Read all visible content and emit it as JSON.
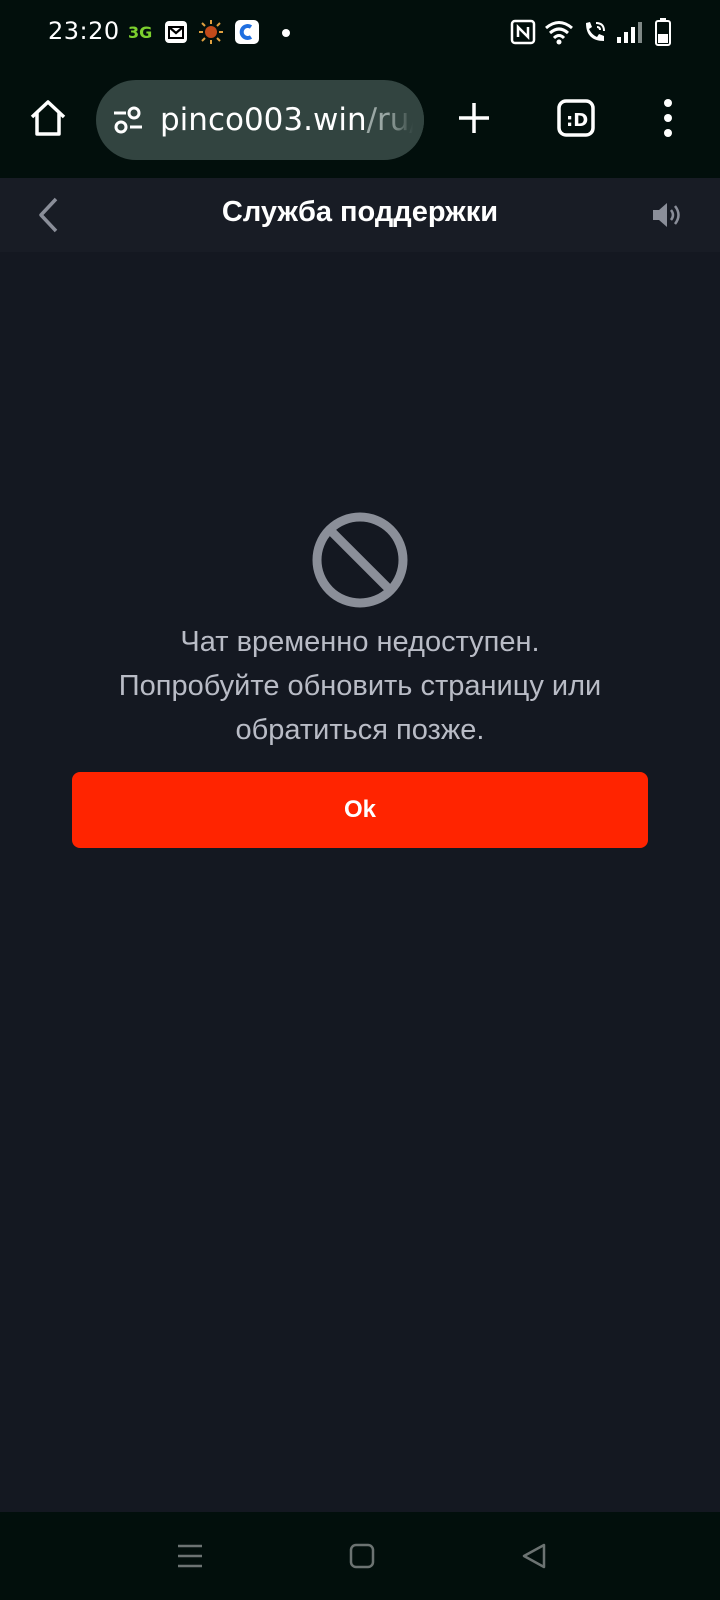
{
  "status_bar": {
    "time": "23:20",
    "notification_icons": [
      "app-3g-icon",
      "gmail-icon",
      "sun-app-icon",
      "browser-app-icon",
      "dot-icon"
    ],
    "system_icons": [
      "nfc-icon",
      "wifi-icon",
      "wifi-calling-icon",
      "signal-icon",
      "battery-icon"
    ]
  },
  "browser": {
    "url_domain": "pinco003.win",
    "url_path": "/ru/",
    "icons": [
      "home-icon",
      "site-settings-icon",
      "new-tab-icon",
      "tab-switcher-icon",
      "more-menu-icon"
    ]
  },
  "header": {
    "title": "Служба поддержки",
    "icons": [
      "back-chevron-icon",
      "sound-icon"
    ]
  },
  "main": {
    "icon": "blocked-icon",
    "message_line1": "Чат временно недоступен.",
    "message_line2": "Попробуйте обновить страницу или",
    "message_line3": "обратиться позже.",
    "button_label": "Ok",
    "button_color": "#ff2400"
  },
  "nav_bar": {
    "icons": [
      "menu-lines-icon",
      "home-square-icon",
      "back-triangle-icon"
    ]
  }
}
